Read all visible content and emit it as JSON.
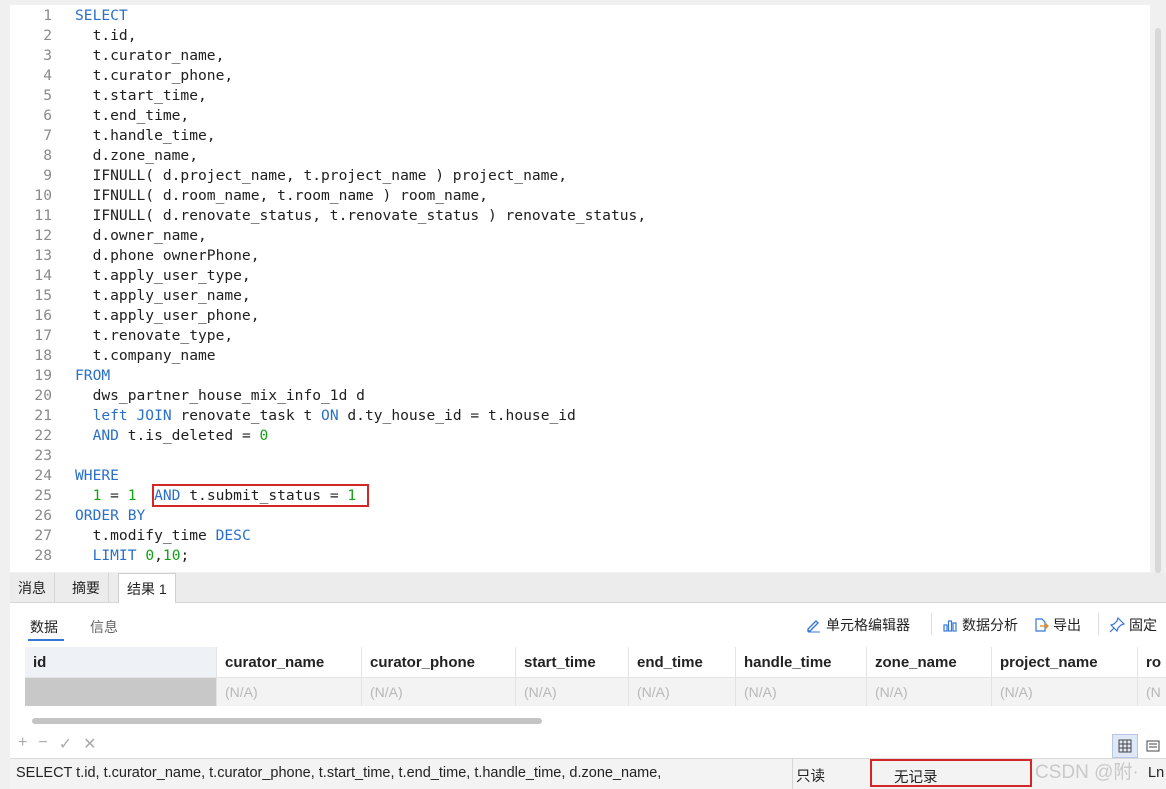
{
  "editor": {
    "lines": [
      {
        "n": "1",
        "tokens": [
          {
            "t": "SELECT",
            "c": "kw"
          }
        ]
      },
      {
        "n": "2",
        "tokens": [
          {
            "t": "  t.id,"
          }
        ]
      },
      {
        "n": "3",
        "tokens": [
          {
            "t": "  t.curator_name,"
          }
        ]
      },
      {
        "n": "4",
        "tokens": [
          {
            "t": "  t.curator_phone,"
          }
        ]
      },
      {
        "n": "5",
        "tokens": [
          {
            "t": "  t.start_time,"
          }
        ]
      },
      {
        "n": "6",
        "tokens": [
          {
            "t": "  t.end_time,"
          }
        ]
      },
      {
        "n": "7",
        "tokens": [
          {
            "t": "  t.handle_time,"
          }
        ]
      },
      {
        "n": "8",
        "tokens": [
          {
            "t": "  d.zone_name,"
          }
        ]
      },
      {
        "n": "9",
        "tokens": [
          {
            "t": "  IFNULL( d.project_name, t.project_name ) project_name,"
          }
        ]
      },
      {
        "n": "10",
        "tokens": [
          {
            "t": "  IFNULL( d.room_name, t.room_name ) room_name,"
          }
        ]
      },
      {
        "n": "11",
        "tokens": [
          {
            "t": "  IFNULL( d.renovate_status, t.renovate_status ) renovate_status,"
          }
        ]
      },
      {
        "n": "12",
        "tokens": [
          {
            "t": "  d.owner_name,"
          }
        ]
      },
      {
        "n": "13",
        "tokens": [
          {
            "t": "  d.phone ownerPhone,"
          }
        ]
      },
      {
        "n": "14",
        "tokens": [
          {
            "t": "  t.apply_user_type,"
          }
        ]
      },
      {
        "n": "15",
        "tokens": [
          {
            "t": "  t.apply_user_name,"
          }
        ]
      },
      {
        "n": "16",
        "tokens": [
          {
            "t": "  t.apply_user_phone,"
          }
        ]
      },
      {
        "n": "17",
        "tokens": [
          {
            "t": "  t.renovate_type,"
          }
        ]
      },
      {
        "n": "18",
        "tokens": [
          {
            "t": "  t.company_name"
          }
        ]
      },
      {
        "n": "19",
        "tokens": [
          {
            "t": "FROM",
            "c": "kw"
          }
        ]
      },
      {
        "n": "20",
        "tokens": [
          {
            "t": "  dws_partner_house_mix_info_1d d"
          }
        ]
      },
      {
        "n": "21",
        "tokens": [
          {
            "t": "  "
          },
          {
            "t": "left JOIN",
            "c": "kw"
          },
          {
            "t": " renovate_task t "
          },
          {
            "t": "ON",
            "c": "kw"
          },
          {
            "t": " d.ty_house_id = t.house_id"
          }
        ]
      },
      {
        "n": "22",
        "tokens": [
          {
            "t": "  "
          },
          {
            "t": "AND",
            "c": "kw"
          },
          {
            "t": " t.is_deleted = "
          },
          {
            "t": "0",
            "c": "num"
          }
        ]
      },
      {
        "n": "23",
        "tokens": [
          {
            "t": ""
          }
        ]
      },
      {
        "n": "24",
        "tokens": [
          {
            "t": "WHERE",
            "c": "kw"
          }
        ]
      },
      {
        "n": "25",
        "tokens": [
          {
            "t": "  "
          },
          {
            "t": "1",
            "c": "num"
          },
          {
            "t": " = "
          },
          {
            "t": "1",
            "c": "num"
          },
          {
            "t": "  "
          },
          {
            "t": "AND",
            "c": "kw"
          },
          {
            "t": " t.submit_status = "
          },
          {
            "t": "1",
            "c": "num"
          }
        ]
      },
      {
        "n": "26",
        "tokens": [
          {
            "t": "ORDER BY",
            "c": "kw"
          }
        ]
      },
      {
        "n": "27",
        "tokens": [
          {
            "t": "  t.modify_time "
          },
          {
            "t": "DESC",
            "c": "kw"
          }
        ]
      },
      {
        "n": "28",
        "tokens": [
          {
            "t": "  "
          },
          {
            "t": "LIMIT",
            "c": "kw"
          },
          {
            "t": " "
          },
          {
            "t": "0",
            "c": "num"
          },
          {
            "t": ","
          },
          {
            "t": "10",
            "c": "num"
          },
          {
            "t": ";"
          }
        ]
      }
    ]
  },
  "result_tabs": [
    "消息",
    "摘要",
    "结果 1"
  ],
  "active_result_tab": "结果 1",
  "sub_tabs": {
    "data": "数据",
    "info": "信息"
  },
  "toolbar": {
    "cell_editor": "单元格编辑器",
    "data_analysis": "数据分析",
    "export": "导出",
    "pin": "固定"
  },
  "grid": {
    "columns": [
      "id",
      "curator_name",
      "curator_phone",
      "start_time",
      "end_time",
      "handle_time",
      "zone_name",
      "project_name",
      "ro"
    ],
    "row": [
      "(N/A)",
      "(N/A)",
      "(N/A)",
      "(N/A)",
      "(N/A)",
      "(N/A)",
      "(N/A)",
      "(N/A)",
      "(N"
    ]
  },
  "status": {
    "sql": "SELECT   t.id,   t.curator_name,   t.curator_phone,   t.start_time,   t.end_time,   t.handle_time,   d.zone_name,",
    "readonly": "只读",
    "records": "无记录",
    "watermark": "CSDN @附·",
    "ln": "Ln"
  },
  "colors": {
    "keyword": "#2a6fc9",
    "number": "#14a014",
    "highlight_border": "#d32626",
    "accent": "#3578d8"
  }
}
